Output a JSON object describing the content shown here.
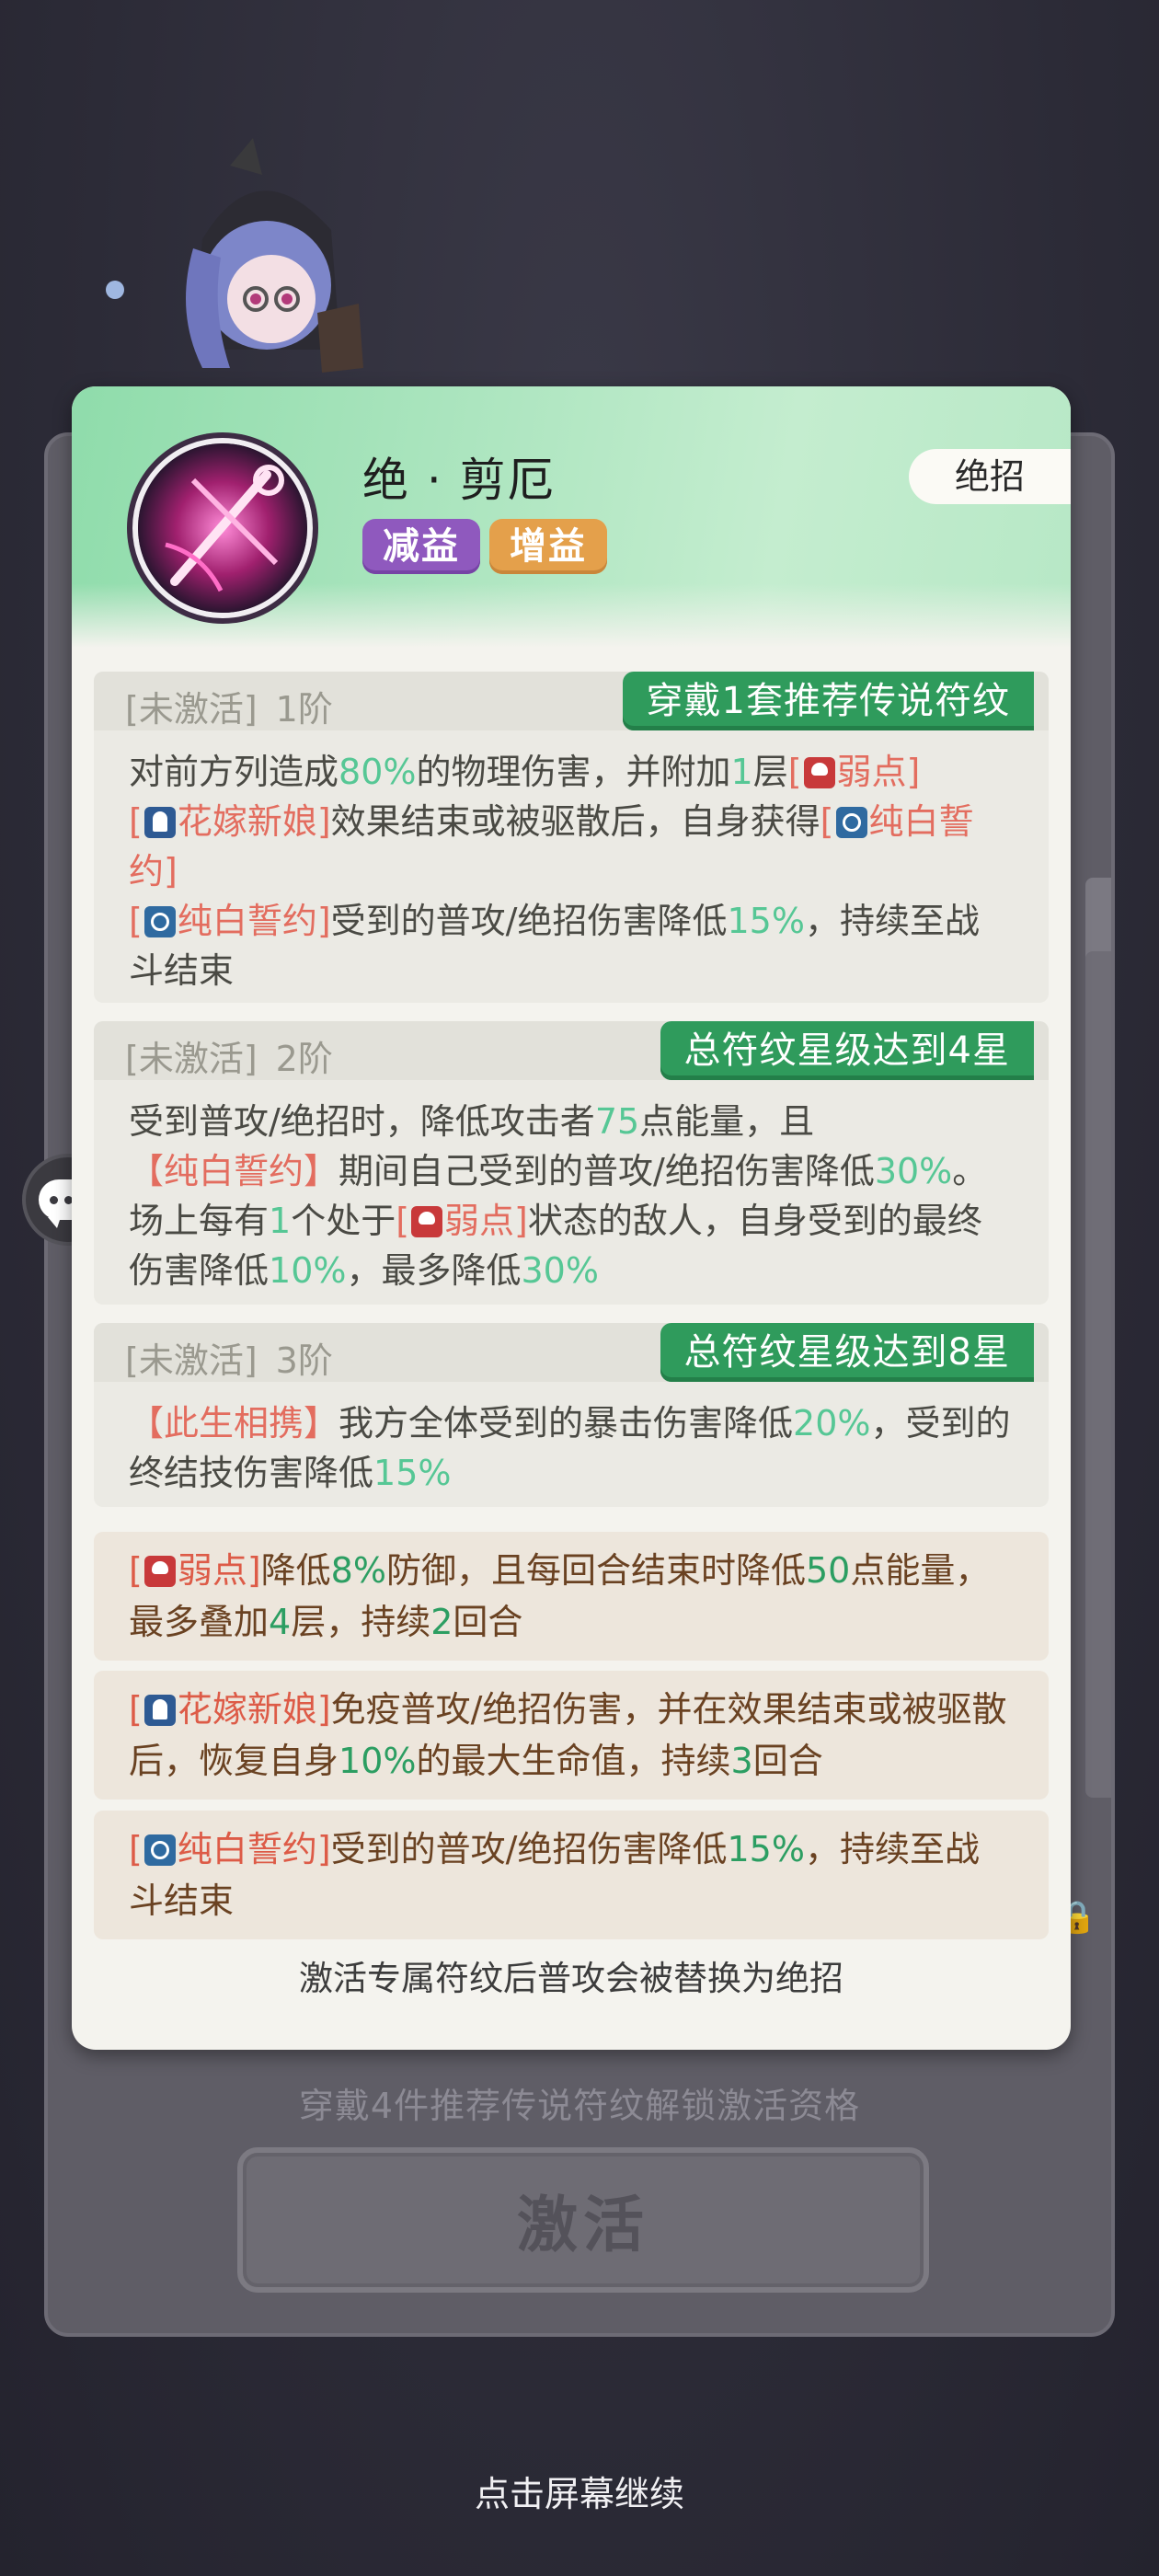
{
  "card": {
    "skill_name": "绝 · 剪厄",
    "type_badge": "绝招",
    "tags": [
      "减益",
      "增益"
    ],
    "tiers": [
      {
        "status": "[未激活]",
        "level": "1阶",
        "requirement": "穿戴1套推荐传说符纹"
      },
      {
        "status": "[未激活]",
        "level": "2阶",
        "requirement": "总符纹星级达到4星"
      },
      {
        "status": "[未激活]",
        "level": "3阶",
        "requirement": "总符纹星级达到8星"
      }
    ],
    "footer_note": "激活专属符纹后普攻会被替换为绝招"
  },
  "unlock_hint": "穿戴4件推荐传说符纹解锁激活资格",
  "activate_label": "激活",
  "continue_label": "点击屏幕继续",
  "colors": {
    "header_green": "#a9e4bd",
    "requirement_badge": "#2f9b5c",
    "tag_debuff": "#8f59be",
    "tag_buff": "#e4a04b",
    "highlight_green": "#56c795",
    "keyword_red": "#e36d5f"
  },
  "icons": [
    "skill-scissors-icon",
    "weak-point-skull-icon",
    "bride-status-icon",
    "white-vow-status-icon",
    "chat-icon",
    "lock-icon"
  ]
}
